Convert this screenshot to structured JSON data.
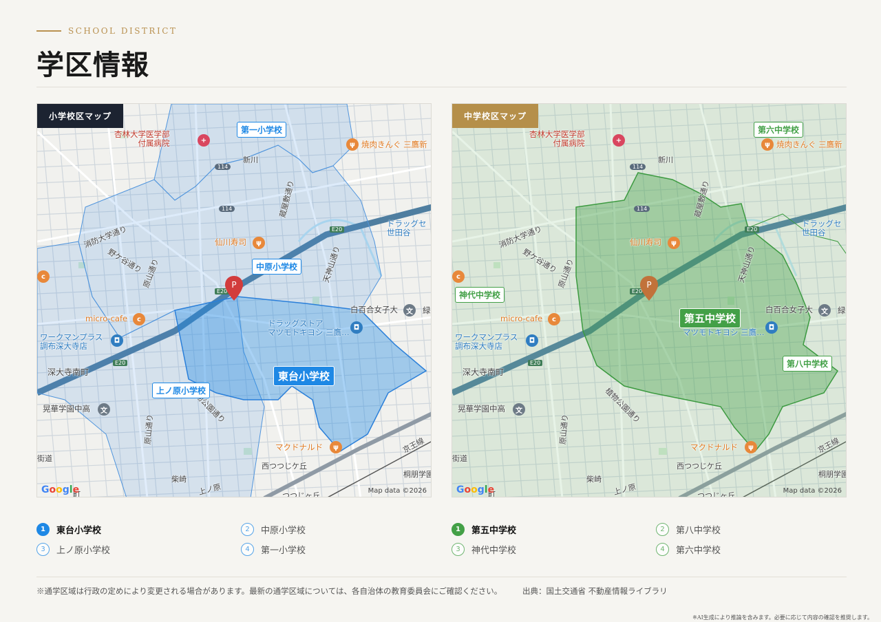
{
  "header": {
    "kicker": "SCHOOL DISTRICT",
    "title": "学区情報"
  },
  "maps": [
    {
      "label": "小学校区マップ",
      "accent": "#1e88e5",
      "label_bg": "#1c2331",
      "schools": [
        "第一小学校",
        "中原小学校",
        "東台小学校",
        "上ノ原小学校"
      ]
    },
    {
      "label": "中学校区マップ",
      "accent": "#43a047",
      "label_bg": "#b58f4a",
      "schools": [
        "第六中学校",
        "神代中学校",
        "第五中学校",
        "第八中学校"
      ]
    }
  ],
  "map_text": {
    "hospital": "杏林大学医学部\n付属病院",
    "yakiniku": "焼肉きんぐ 三鷹新",
    "shinkawa": "新川",
    "senkawa_sushi": "仙川寿司",
    "drugstore_top": "ドラッグセ\n世田谷",
    "dori_shouboudai": "消防大学通り",
    "dori_nogaya": "野ケ谷通り",
    "dori_harayama": "原山通り",
    "dori_tenjinyama": "天神山通り",
    "dori_shokubutsu": "植物公園通り",
    "dori_kurayashiki": "蔵屋敷通り",
    "shirayuri": "白百合女子大",
    "midori": "緑",
    "micro_cafe": "micro-cafe",
    "drugstore": "ドラッグストア\nマツモトキヨシ 三鷹…",
    "workman": "ワークマンプラス\n調布深大寺店",
    "jindaiji": "深大寺南町",
    "koka": "晃華学園中高",
    "kaido": "街道",
    "mcdonalds": "マクドナルド",
    "shibasaki": "柴崎",
    "nishi_tsutsujigaoka": "西つつじケ丘",
    "tsutsujigaoka": "つつじヶ丘",
    "toho": "桐朋学園",
    "keio": "京王線",
    "kami": "上ノ原",
    "machi": "町",
    "route_114": "114",
    "e20": "E20",
    "parking": "P",
    "credit": "Map data ©2026",
    "google": [
      "G",
      "o",
      "o",
      "g",
      "l",
      "e"
    ]
  },
  "elementary_list": [
    {
      "num": "1",
      "name": "東台小学校",
      "active": true
    },
    {
      "num": "2",
      "name": "中原小学校",
      "active": false
    },
    {
      "num": "3",
      "name": "上ノ原小学校",
      "active": false
    },
    {
      "num": "4",
      "name": "第一小学校",
      "active": false
    }
  ],
  "junior_list": [
    {
      "num": "1",
      "name": "第五中学校",
      "active": true
    },
    {
      "num": "2",
      "name": "第八中学校",
      "active": false
    },
    {
      "num": "3",
      "name": "神代中学校",
      "active": false
    },
    {
      "num": "4",
      "name": "第六中学校",
      "active": false
    }
  ],
  "footer": {
    "note": "※通学区域は行政の定めにより変更される場合があります。最新の通学区域については、各自治体の教育委員会にご確認ください。",
    "source": "出典：国土交通省 不動産情報ライブラリ",
    "disclaimer": "※AI生成により推論を含みます。必要に応じて内容の確認を推奨します。"
  }
}
